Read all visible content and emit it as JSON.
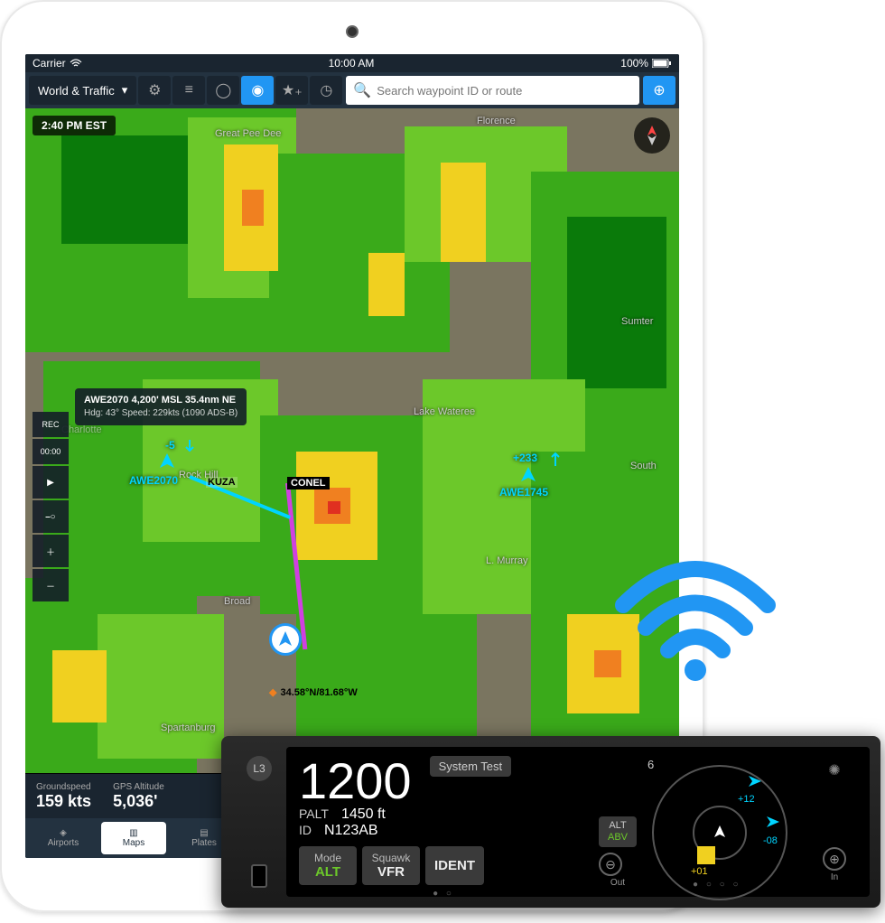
{
  "statusbar": {
    "carrier": "Carrier",
    "time": "10:00 AM",
    "battery": "100%"
  },
  "toolbar": {
    "mode_label": "World & Traffic",
    "search_placeholder": "Search waypoint ID or route"
  },
  "time_badge": "2:40 PM EST",
  "map_labels": {
    "great_pee_dee": "Great Pee Dee",
    "florence": "Florence",
    "sumter": "Sumter",
    "charlotte": "Charlotte",
    "rock_hill": "Rock Hill",
    "lake_wateree": "Lake Wateree",
    "broad": "Broad",
    "murray": "L. Murray",
    "spartanburg": "Spartanburg",
    "south": "South"
  },
  "traffic_tip": {
    "line1": "AWE2070 4,200' MSL 35.4nm NE",
    "line2": "Hdg:  43°   Speed: 229kts (1090 ADS-B)"
  },
  "traffic": {
    "a1_alt": "-5",
    "a1_callsign": "AWE2070",
    "a2_alt": "+233",
    "a2_callsign": "AWE1745"
  },
  "waypoints": {
    "kuza": "KUZA",
    "conel": "CONEL",
    "coords": "34.58°N/81.68°W"
  },
  "rec": {
    "label": "REC",
    "time": "00:00"
  },
  "databar": {
    "gs_label": "Groundspeed",
    "gs_value": "159 kts",
    "alt_label": "GPS Altitude",
    "alt_value": "5,036'"
  },
  "tabs": {
    "airports": "Airports",
    "maps": "Maps",
    "plates": "Plates"
  },
  "xpdr": {
    "logo": "L3",
    "code": "1200",
    "status": "System Test",
    "palt_label": "PALT",
    "palt_value": "1450 ft",
    "id_label": "ID",
    "id_value": "N123AB",
    "btn_mode_top": "Mode",
    "btn_mode_bot": "ALT",
    "btn_sq_top": "Squawk",
    "btn_sq_bot": "VFR",
    "btn_ident": "IDENT",
    "alt_pill_top": "ALT",
    "alt_pill_bot": "ABV",
    "range": "6",
    "tgt1": "+12",
    "tgt2": "+01",
    "tgt3": "-08",
    "out": "Out",
    "in": "In"
  }
}
